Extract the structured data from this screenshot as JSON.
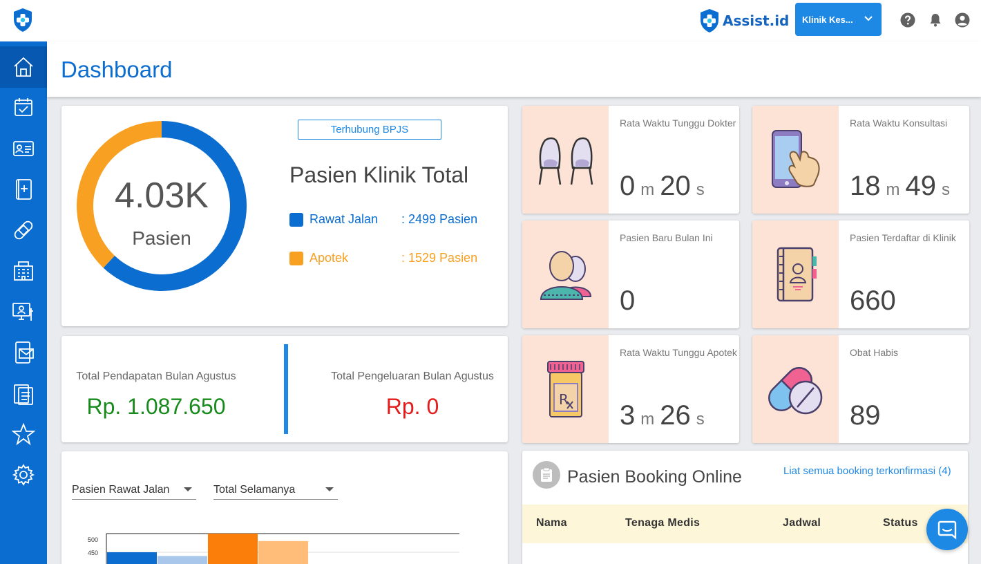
{
  "topbar": {
    "brand": "Assist.id",
    "clinic_select": "Klinik Kes...",
    "icons": [
      "help-icon",
      "bell-icon",
      "account-icon"
    ]
  },
  "sidebar": {
    "items": [
      {
        "name": "home",
        "icon": "home-icon",
        "active": true
      },
      {
        "name": "schedule",
        "icon": "calendar-check-icon"
      },
      {
        "name": "patients",
        "icon": "id-card-icon"
      },
      {
        "name": "medical-record",
        "icon": "medical-book-icon"
      },
      {
        "name": "pharmacy",
        "icon": "bandage-icon"
      },
      {
        "name": "facility",
        "icon": "building-icon"
      },
      {
        "name": "telemedicine",
        "icon": "monitor-doctor-icon"
      },
      {
        "name": "messages",
        "icon": "mobile-mail-icon"
      },
      {
        "name": "reports",
        "icon": "clipboard-icon"
      },
      {
        "name": "rating",
        "icon": "star-icon"
      },
      {
        "name": "settings",
        "icon": "gear-icon"
      }
    ]
  },
  "header": {
    "title": "Dashboard"
  },
  "total_patients": {
    "value": "4.03K",
    "unit": "Pasien",
    "badge": "Terhubung BPJS",
    "title": "Pasien Klinik Total",
    "legend": [
      {
        "name": "Rawat Jalan",
        "value": ": 2499 Pasien",
        "count": 2499,
        "color": "#0b6dcf"
      },
      {
        "name": "Apotek",
        "value": ": 1529 Pasien",
        "count": 1529,
        "color": "#f7a021"
      }
    ]
  },
  "revenue": {
    "income_label": "Total Pendapatan Bulan Agustus",
    "income_value": "Rp. 1.087.650",
    "expense_label": "Total Pengeluaran Bulan Agustus",
    "expense_value": "Rp. 0"
  },
  "stats": {
    "wait_doctor": {
      "label": "Rata Waktu Tunggu Dokter",
      "min": "0",
      "min_unit": "m",
      "sec": "20",
      "sec_unit": "s",
      "icon": "waiting-chairs-icon"
    },
    "consult": {
      "label": "Rata Waktu Konsultasi",
      "min": "18",
      "min_unit": "m",
      "sec": "49",
      "sec_unit": "s",
      "icon": "phone-touch-icon"
    },
    "new_patients": {
      "label": "Pasien Baru Bulan Ini",
      "value": "0",
      "icon": "patients-group-icon"
    },
    "registered": {
      "label": "Pasien Terdaftar di Klinik",
      "value": "660",
      "icon": "patient-book-icon"
    },
    "wait_pharmacy": {
      "label": "Rata Waktu Tunggu Apotek",
      "min": "3",
      "min_unit": "m",
      "sec": "26",
      "sec_unit": "s",
      "icon": "rx-bottle-icon"
    },
    "out_of_stock": {
      "label": "Obat Habis",
      "value": "89",
      "icon": "pill-capsule-icon"
    }
  },
  "chart_panel": {
    "filter_type": "Pasien Rawat Jalan",
    "filter_period": "Total Selamanya"
  },
  "chart_data": {
    "type": "bar",
    "yticks": [
      "500",
      "450"
    ],
    "ylim": [
      400,
      500
    ],
    "values": [
      450,
      440,
      500,
      480
    ],
    "colors": [
      "#0b6dcf",
      "#a9c7ea",
      "#fb7d0a",
      "#ffbd79"
    ]
  },
  "booking": {
    "title": "Pasien Booking Online",
    "link": "Liat semua booking terkonfirmasi (4)",
    "columns": [
      "Nama",
      "Tenaga Medis",
      "Jadwal",
      "Status"
    ]
  }
}
